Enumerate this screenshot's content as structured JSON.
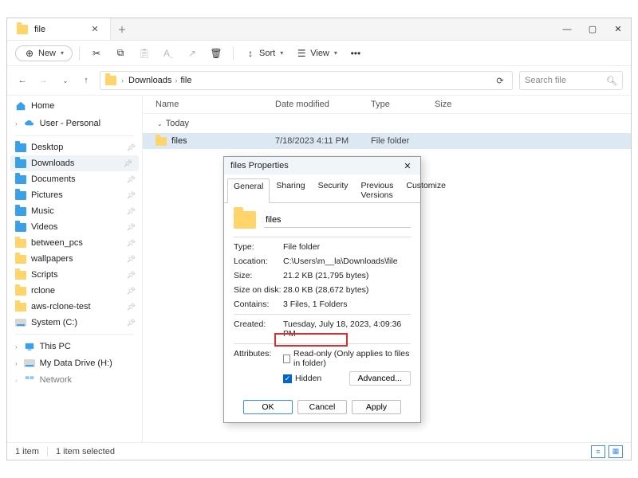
{
  "tab": {
    "title": "file"
  },
  "winctrl": {
    "min": "—",
    "max": "▢",
    "close": "✕"
  },
  "toolbar": {
    "new_label": "New",
    "sort_label": "Sort",
    "view_label": "View"
  },
  "breadcrumb": {
    "items": [
      "Downloads",
      "file"
    ],
    "refresh": "↻"
  },
  "search": {
    "placeholder": "Search file"
  },
  "sidebar": {
    "home": "Home",
    "personal": "User - Personal",
    "items": [
      {
        "label": "Desktop"
      },
      {
        "label": "Downloads",
        "active": true
      },
      {
        "label": "Documents"
      },
      {
        "label": "Pictures"
      },
      {
        "label": "Music"
      },
      {
        "label": "Videos"
      },
      {
        "label": "between_pcs"
      },
      {
        "label": "wallpapers"
      },
      {
        "label": "Scripts"
      },
      {
        "label": "rclone"
      },
      {
        "label": "aws-rclone-test"
      },
      {
        "label": "System (C:)"
      }
    ],
    "thispc": "This PC",
    "drive_h": "My Data Drive (H:)",
    "network": "Network"
  },
  "columns": {
    "name": "Name",
    "date": "Date modified",
    "type": "Type",
    "size": "Size"
  },
  "group": "Today",
  "rows": [
    {
      "name": "files",
      "date": "7/18/2023 4:11 PM",
      "type": "File folder",
      "size": ""
    }
  ],
  "status": {
    "count": "1 item",
    "selected": "1 item selected"
  },
  "dialog": {
    "title": "files Properties",
    "tabs": [
      "General",
      "Sharing",
      "Security",
      "Previous Versions",
      "Customize"
    ],
    "name_value": "files",
    "type_label": "Type:",
    "type_value": "File folder",
    "loc_label": "Location:",
    "loc_value": "C:\\Users\\m__la\\Downloads\\file",
    "size_label": "Size:",
    "size_value": "21.2 KB (21,795 bytes)",
    "sod_label": "Size on disk:",
    "sod_value": "28.0 KB (28,672 bytes)",
    "cont_label": "Contains:",
    "cont_value": "3 Files, 1 Folders",
    "created_label": "Created:",
    "created_value": "Tuesday, July 18, 2023, 4:09:36 PM",
    "attr_label": "Attributes:",
    "readonly": "Read-only (Only applies to files in folder)",
    "hidden": "Hidden",
    "advanced": "Advanced...",
    "ok": "OK",
    "cancel": "Cancel",
    "apply": "Apply"
  }
}
